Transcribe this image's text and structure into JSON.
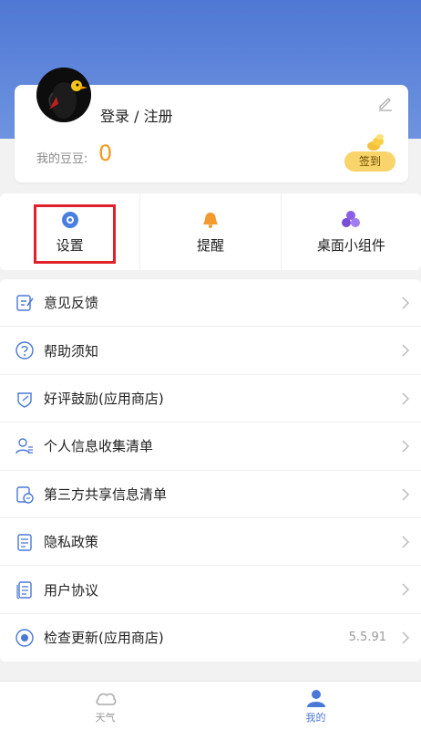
{
  "profile": {
    "login_label": "登录 / 注册",
    "beans_label": "我的豆豆:",
    "beans_value": "0",
    "signin_label": "签到"
  },
  "shortcuts": [
    {
      "label": "设置",
      "icon": "gear-icon",
      "color": "#4a7fe0"
    },
    {
      "label": "提醒",
      "icon": "bell-icon",
      "color": "#f29a2e"
    },
    {
      "label": "桌面小组件",
      "icon": "widget-icon",
      "color": "#8a5fe6"
    }
  ],
  "menu": [
    {
      "label": "意见反馈",
      "icon": "feedback-icon"
    },
    {
      "label": "帮助须知",
      "icon": "help-icon"
    },
    {
      "label": "好评鼓励(应用商店)",
      "icon": "rating-icon"
    },
    {
      "label": "个人信息收集清单",
      "icon": "user-list-icon"
    },
    {
      "label": "第三方共享信息清单",
      "icon": "share-list-icon"
    },
    {
      "label": "隐私政策",
      "icon": "privacy-icon"
    },
    {
      "label": "用户协议",
      "icon": "agreement-icon"
    },
    {
      "label": "检查更新(应用商店)",
      "icon": "update-icon",
      "value": "5.5.91"
    }
  ],
  "tabs": [
    {
      "label": "天气",
      "icon": "cloud-icon",
      "active": false
    },
    {
      "label": "我的",
      "icon": "person-icon",
      "active": true
    }
  ],
  "colors": {
    "header_gradient_top": "#4f78d4",
    "accent_blue": "#4a78d8",
    "beans_orange": "#f39a1e",
    "highlight_red": "#e0202a",
    "signin_yellow": "#f8d46a"
  }
}
